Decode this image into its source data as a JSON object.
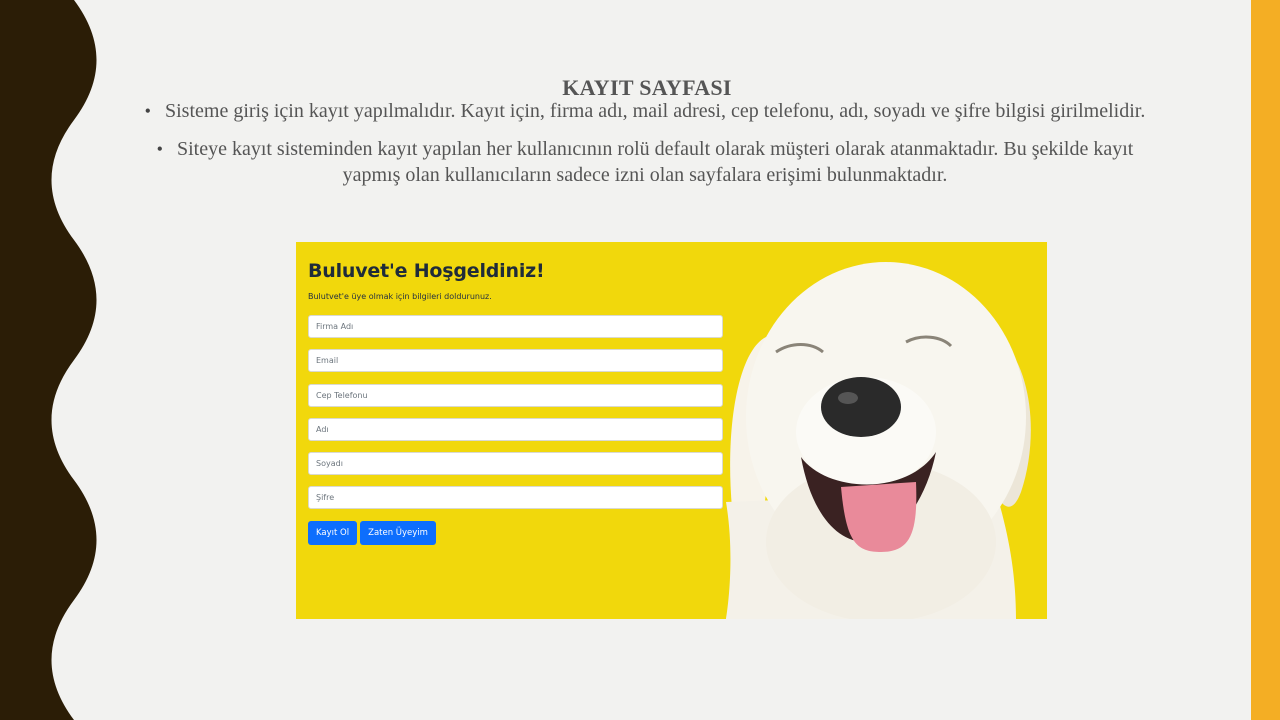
{
  "slide": {
    "title": "KAYIT SAYFASI",
    "bullets": [
      "Sisteme giriş için kayıt yapılmalıdır. Kayıt için, firma adı, mail adresi, cep telefonu, adı, soyadı ve şifre bilgisi girilmelidir.",
      "Siteye kayıt sisteminden kayıt yapılan her kullanıcının rolü default olarak müşteri olarak atanmaktadır. Bu şekilde kayıt yapmış olan kullanıcıların sadece izni olan sayfalara erişimi bulunmaktadır."
    ],
    "bullet_glyph": "•"
  },
  "colors": {
    "wave_dark": "#2b1d06",
    "accent": "#f4ae24",
    "screenshot_bg": "#f1d80c",
    "button": "#0d6efd"
  },
  "form_screenshot": {
    "heading": "Buluvet'e Hoşgeldiniz!",
    "subtext": "Bulutvet'e üye olmak için bilgileri doldurunuz.",
    "fields": [
      {
        "placeholder": "Firma Adı"
      },
      {
        "placeholder": "Email"
      },
      {
        "placeholder": "Cep Telefonu"
      },
      {
        "placeholder": "Adı"
      },
      {
        "placeholder": "Soyadı"
      },
      {
        "placeholder": "Şifre"
      }
    ],
    "buttons": {
      "register": "Kayıt Ol",
      "already_member": "Zaten Üyeyim"
    },
    "image": "smiling-white-dog"
  }
}
